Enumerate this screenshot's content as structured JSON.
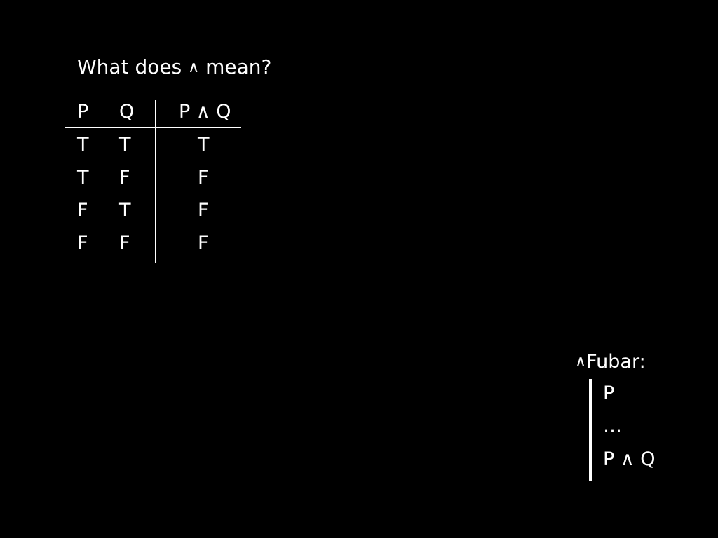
{
  "title": {
    "before": "What does",
    "symbol": "∧",
    "after": "mean?"
  },
  "truth_table": {
    "headers": [
      "P",
      "Q",
      "P ∧ Q"
    ],
    "rows": [
      [
        "T",
        "T",
        "T"
      ],
      [
        "T",
        "F",
        "F"
      ],
      [
        "F",
        "T",
        "F"
      ],
      [
        "F",
        "F",
        "F"
      ]
    ]
  },
  "rule": {
    "symbol": "∧",
    "name": "Fubar:",
    "lines": [
      "P",
      "…",
      "P ∧ Q"
    ]
  }
}
